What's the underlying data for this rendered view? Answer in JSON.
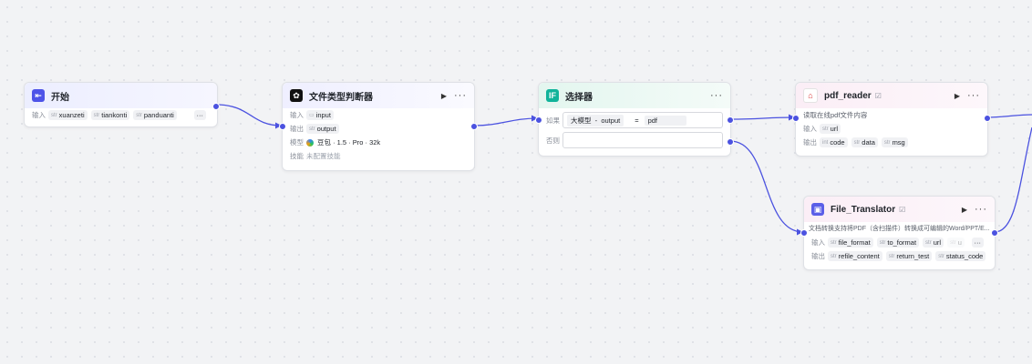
{
  "start": {
    "title": "开始",
    "input_label": "输入",
    "inputs": [
      {
        "type": "str",
        "name": "xuanzeti"
      },
      {
        "type": "str",
        "name": "tiankonti"
      },
      {
        "type": "str",
        "name": "panduanti"
      }
    ],
    "more": "···",
    "icon": "start-icon"
  },
  "classifier": {
    "title": "文件类型判断器",
    "input_label": "输入",
    "input_value": "input",
    "output_label": "输出",
    "output_type": "str",
    "output_value": "output",
    "model_label": "模型",
    "model_value": "豆包 · 1.5 · Pro · 32k",
    "skill_label": "技能",
    "skill_value": "未配置技能",
    "icon": "llm-icon"
  },
  "selector": {
    "title": "选择器",
    "icon_text": "IF",
    "if_label": "如果",
    "else_label": "否则",
    "cond_left_a": "大模型",
    "cond_sep": "-",
    "cond_left_b": "output",
    "cond_op": "=",
    "cond_right": "pdf"
  },
  "pdf_reader": {
    "title": "pdf_reader",
    "desc": "读取在线pdf文件内容",
    "input_label": "输入",
    "inputs": [
      {
        "type": "str",
        "name": "url"
      }
    ],
    "output_label": "输出",
    "outputs": [
      {
        "type": "int",
        "name": "code"
      },
      {
        "type": "str",
        "name": "data"
      },
      {
        "type": "str",
        "name": "msg"
      }
    ]
  },
  "translator": {
    "title": "File_Translator",
    "desc": "文档转换支持将PDF（含扫描件）转换成可编辑的Word/PPT/E...",
    "input_label": "输入",
    "inputs": [
      {
        "type": "str",
        "name": "file_format"
      },
      {
        "type": "str",
        "name": "to_format"
      },
      {
        "type": "str",
        "name": "url"
      },
      {
        "type": "str",
        "name": "u"
      }
    ],
    "output_label": "输出",
    "outputs": [
      {
        "type": "str",
        "name": "refile_content"
      },
      {
        "type": "str",
        "name": "return_test"
      },
      {
        "type": "str",
        "name": "status_code"
      }
    ]
  },
  "ui": {
    "run": "▶",
    "more": "···",
    "check": "☑"
  },
  "colors": {
    "edge": "#4b52e0",
    "start_icon": "#4d53e8",
    "if_icon": "#10b39a",
    "plugin_icon": "#5b5fe8"
  }
}
